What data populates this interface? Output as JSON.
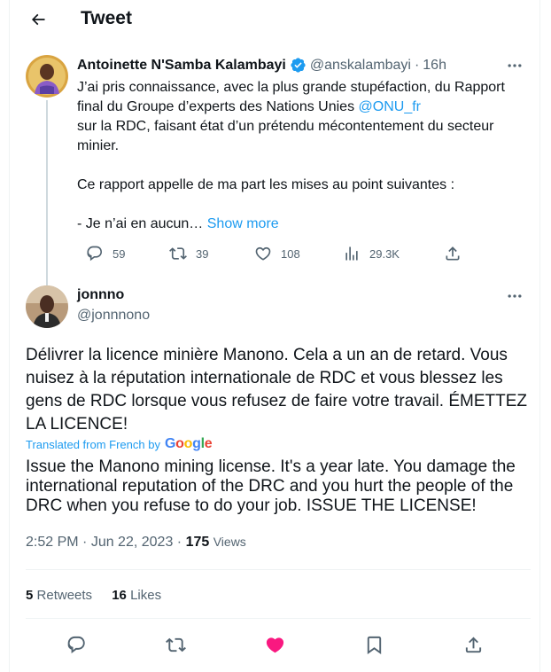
{
  "header": {
    "title": "Tweet"
  },
  "quoted": {
    "name": "Antoinette N'Samba Kalambayi",
    "handle": "@anskalambayi",
    "separator": "·",
    "time": "16h",
    "text_part1": "J’ai pris connaissance, avec la plus grande stupéfaction, du Rapport final du Groupe d’experts des Nations Unies ",
    "mention": "@ONU_fr",
    "text_part2": "\nsur la RDC, faisant état d’un prétendu mécontentement du secteur minier.\n\nCe rapport appelle de ma part les mises au point suivantes :\n\n- Je n’ai en aucun… ",
    "show_more": "Show more",
    "replies": "59",
    "retweets": "39",
    "likes": "108",
    "views": "29.3K"
  },
  "main": {
    "name": "jonnno",
    "handle": "@jonnnono",
    "text": "Délivrer la licence minière Manono. Cela a un an de retard. Vous nuisez à la réputation internationale de RDC et vous blessez les gens de RDC lorsque vous refusez de faire votre travail. ÉMETTEZ LA LICENCE!",
    "translated_label": "Translated from French by",
    "translated_brand": "Google",
    "translation": "Issue the Manono mining license. It's a year late. You damage the international reputation of the DRC and you hurt the people of the DRC when you refuse to do your job. ISSUE THE LICENSE!",
    "time": "2:52 PM",
    "date_separator": " · ",
    "date": "Jun 22, 2023",
    "views_count": "175",
    "views_label": "Views",
    "retweets_count": "5",
    "retweets_label": "Retweets",
    "likes_count": "16",
    "likes_label": "Likes"
  },
  "colors": {
    "accent": "#1d9bf0",
    "like": "#f91880",
    "muted": "#536471",
    "text": "#0f1419"
  }
}
